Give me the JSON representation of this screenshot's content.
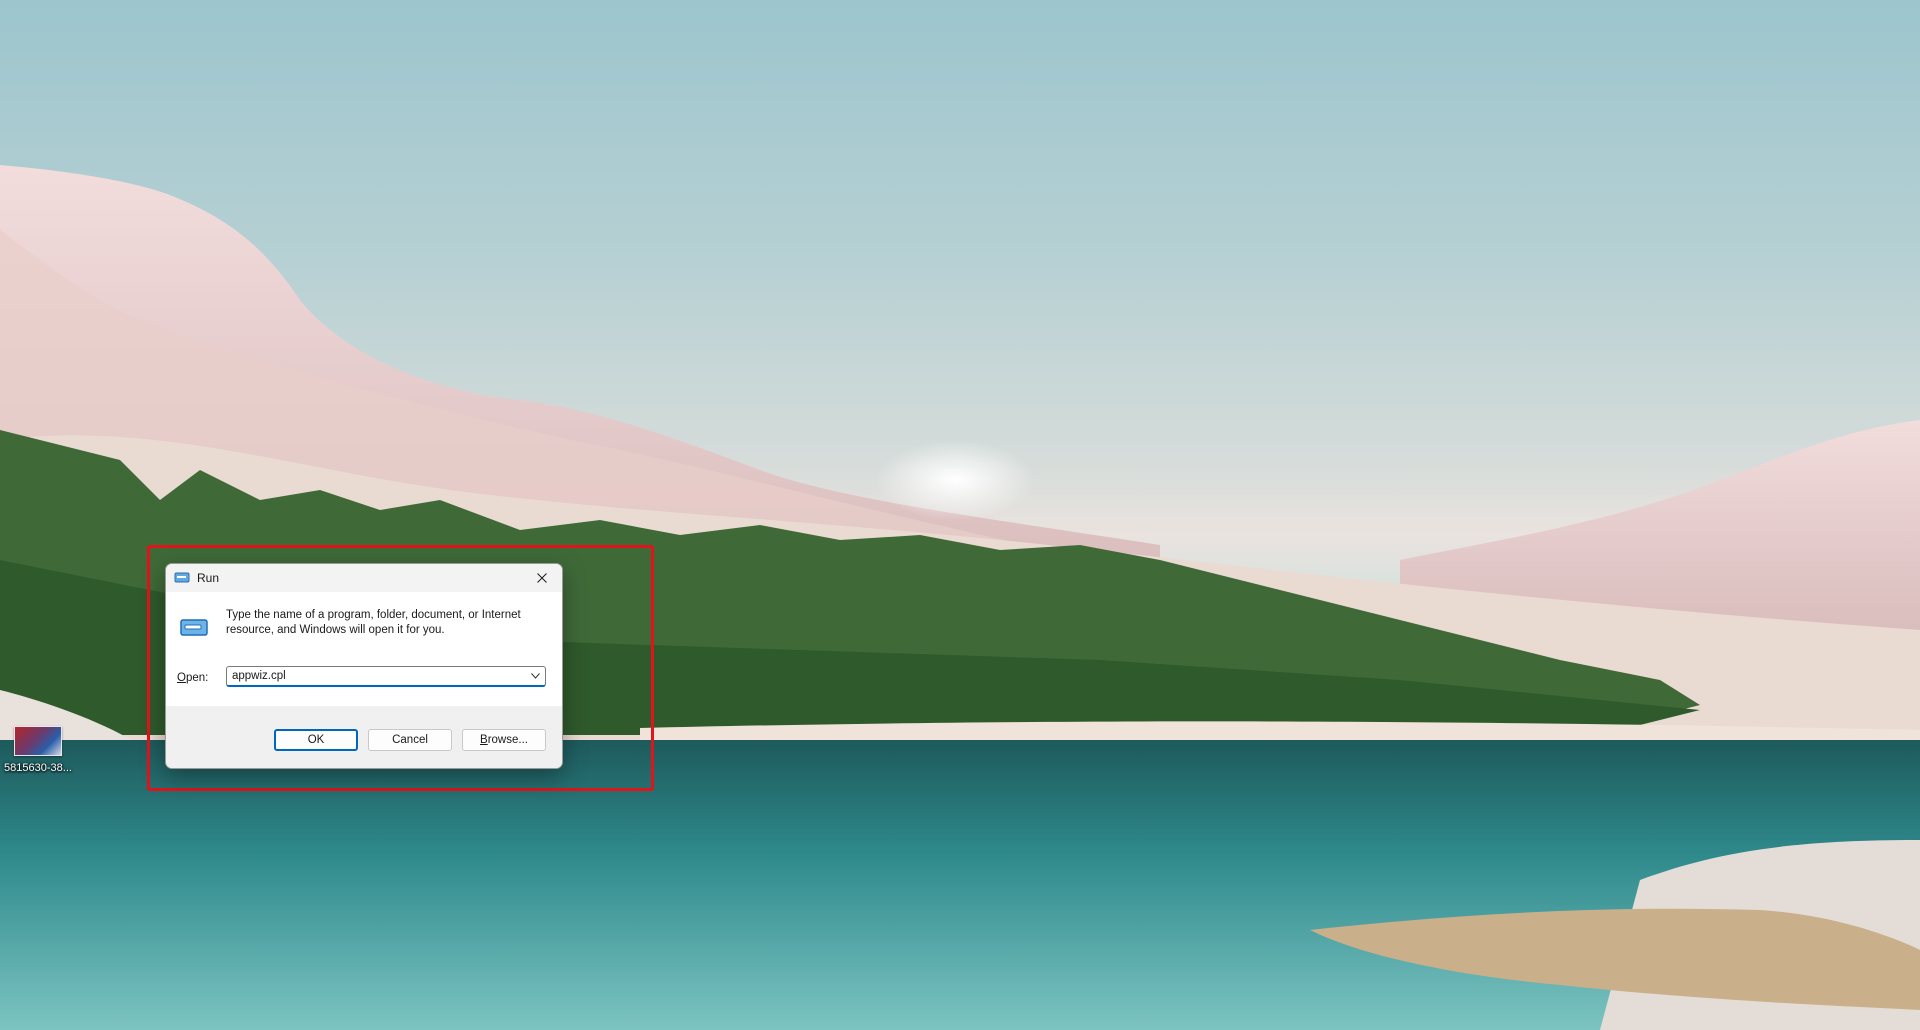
{
  "desktop": {
    "icons": [
      {
        "label": "5815630-38...",
        "icon": "image-file-icon"
      }
    ]
  },
  "run_dialog": {
    "title": "Run",
    "close_icon": "close-icon",
    "instructions": "Type the name of a program, folder, document, or Internet resource, and Windows will open it for you.",
    "open_label_accel": "O",
    "open_label_rest": "pen:",
    "open_value": "appwiz.cpl",
    "buttons": {
      "ok": "OK",
      "cancel": "Cancel",
      "browse_accel": "B",
      "browse_rest": "rowse..."
    }
  },
  "colors": {
    "highlight": "#e0141b",
    "accent": "#0067c0"
  }
}
